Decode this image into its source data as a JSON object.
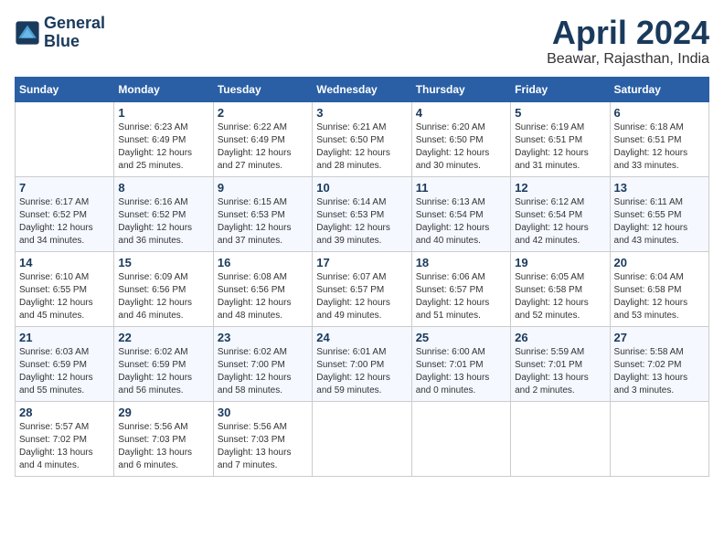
{
  "header": {
    "logo_line1": "General",
    "logo_line2": "Blue",
    "month_title": "April 2024",
    "location": "Beawar, Rajasthan, India"
  },
  "days_of_week": [
    "Sunday",
    "Monday",
    "Tuesday",
    "Wednesday",
    "Thursday",
    "Friday",
    "Saturday"
  ],
  "weeks": [
    [
      {
        "day": "",
        "info": ""
      },
      {
        "day": "1",
        "info": "Sunrise: 6:23 AM\nSunset: 6:49 PM\nDaylight: 12 hours\nand 25 minutes."
      },
      {
        "day": "2",
        "info": "Sunrise: 6:22 AM\nSunset: 6:49 PM\nDaylight: 12 hours\nand 27 minutes."
      },
      {
        "day": "3",
        "info": "Sunrise: 6:21 AM\nSunset: 6:50 PM\nDaylight: 12 hours\nand 28 minutes."
      },
      {
        "day": "4",
        "info": "Sunrise: 6:20 AM\nSunset: 6:50 PM\nDaylight: 12 hours\nand 30 minutes."
      },
      {
        "day": "5",
        "info": "Sunrise: 6:19 AM\nSunset: 6:51 PM\nDaylight: 12 hours\nand 31 minutes."
      },
      {
        "day": "6",
        "info": "Sunrise: 6:18 AM\nSunset: 6:51 PM\nDaylight: 12 hours\nand 33 minutes."
      }
    ],
    [
      {
        "day": "7",
        "info": "Sunrise: 6:17 AM\nSunset: 6:52 PM\nDaylight: 12 hours\nand 34 minutes."
      },
      {
        "day": "8",
        "info": "Sunrise: 6:16 AM\nSunset: 6:52 PM\nDaylight: 12 hours\nand 36 minutes."
      },
      {
        "day": "9",
        "info": "Sunrise: 6:15 AM\nSunset: 6:53 PM\nDaylight: 12 hours\nand 37 minutes."
      },
      {
        "day": "10",
        "info": "Sunrise: 6:14 AM\nSunset: 6:53 PM\nDaylight: 12 hours\nand 39 minutes."
      },
      {
        "day": "11",
        "info": "Sunrise: 6:13 AM\nSunset: 6:54 PM\nDaylight: 12 hours\nand 40 minutes."
      },
      {
        "day": "12",
        "info": "Sunrise: 6:12 AM\nSunset: 6:54 PM\nDaylight: 12 hours\nand 42 minutes."
      },
      {
        "day": "13",
        "info": "Sunrise: 6:11 AM\nSunset: 6:55 PM\nDaylight: 12 hours\nand 43 minutes."
      }
    ],
    [
      {
        "day": "14",
        "info": "Sunrise: 6:10 AM\nSunset: 6:55 PM\nDaylight: 12 hours\nand 45 minutes."
      },
      {
        "day": "15",
        "info": "Sunrise: 6:09 AM\nSunset: 6:56 PM\nDaylight: 12 hours\nand 46 minutes."
      },
      {
        "day": "16",
        "info": "Sunrise: 6:08 AM\nSunset: 6:56 PM\nDaylight: 12 hours\nand 48 minutes."
      },
      {
        "day": "17",
        "info": "Sunrise: 6:07 AM\nSunset: 6:57 PM\nDaylight: 12 hours\nand 49 minutes."
      },
      {
        "day": "18",
        "info": "Sunrise: 6:06 AM\nSunset: 6:57 PM\nDaylight: 12 hours\nand 51 minutes."
      },
      {
        "day": "19",
        "info": "Sunrise: 6:05 AM\nSunset: 6:58 PM\nDaylight: 12 hours\nand 52 minutes."
      },
      {
        "day": "20",
        "info": "Sunrise: 6:04 AM\nSunset: 6:58 PM\nDaylight: 12 hours\nand 53 minutes."
      }
    ],
    [
      {
        "day": "21",
        "info": "Sunrise: 6:03 AM\nSunset: 6:59 PM\nDaylight: 12 hours\nand 55 minutes."
      },
      {
        "day": "22",
        "info": "Sunrise: 6:02 AM\nSunset: 6:59 PM\nDaylight: 12 hours\nand 56 minutes."
      },
      {
        "day": "23",
        "info": "Sunrise: 6:02 AM\nSunset: 7:00 PM\nDaylight: 12 hours\nand 58 minutes."
      },
      {
        "day": "24",
        "info": "Sunrise: 6:01 AM\nSunset: 7:00 PM\nDaylight: 12 hours\nand 59 minutes."
      },
      {
        "day": "25",
        "info": "Sunrise: 6:00 AM\nSunset: 7:01 PM\nDaylight: 13 hours\nand 0 minutes."
      },
      {
        "day": "26",
        "info": "Sunrise: 5:59 AM\nSunset: 7:01 PM\nDaylight: 13 hours\nand 2 minutes."
      },
      {
        "day": "27",
        "info": "Sunrise: 5:58 AM\nSunset: 7:02 PM\nDaylight: 13 hours\nand 3 minutes."
      }
    ],
    [
      {
        "day": "28",
        "info": "Sunrise: 5:57 AM\nSunset: 7:02 PM\nDaylight: 13 hours\nand 4 minutes."
      },
      {
        "day": "29",
        "info": "Sunrise: 5:56 AM\nSunset: 7:03 PM\nDaylight: 13 hours\nand 6 minutes."
      },
      {
        "day": "30",
        "info": "Sunrise: 5:56 AM\nSunset: 7:03 PM\nDaylight: 13 hours\nand 7 minutes."
      },
      {
        "day": "",
        "info": ""
      },
      {
        "day": "",
        "info": ""
      },
      {
        "day": "",
        "info": ""
      },
      {
        "day": "",
        "info": ""
      }
    ]
  ]
}
